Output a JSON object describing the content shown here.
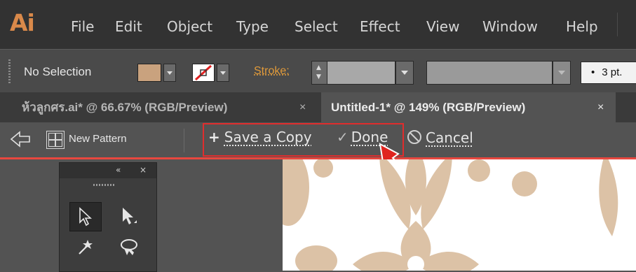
{
  "app": {
    "logo": "Ai"
  },
  "menubar": {
    "items": [
      "File",
      "Edit",
      "Object",
      "Type",
      "Select",
      "Effect",
      "View",
      "Window",
      "Help"
    ]
  },
  "control_bar": {
    "selection_label": "No Selection",
    "fill_color": "#c9a27e",
    "stroke_label": "Stroke:",
    "size_value": "3 pt.",
    "bullet": "•"
  },
  "tabs": [
    {
      "label": "ห้วลูกศร.ai* @ 66.67% (RGB/Preview)",
      "close": "×",
      "active": false
    },
    {
      "label": "Untitled-1* @ 149% (RGB/Preview)",
      "close": "×",
      "active": true
    }
  ],
  "pattern_bar": {
    "new_pattern_label": "New Pattern",
    "save_copy_label": "Save a Copy",
    "done_label": "Done",
    "cancel_label": "Cancel",
    "plus_glyph": "+",
    "check_glyph": "✓"
  },
  "tools_panel": {
    "collapse_glyph": "«",
    "close_glyph": "×"
  },
  "colors": {
    "accent_orange": "#d9894a",
    "pattern_edit_red": "#e8473f",
    "highlight_red": "#e02d2d",
    "artwork_tan": "#dcc2a6"
  }
}
